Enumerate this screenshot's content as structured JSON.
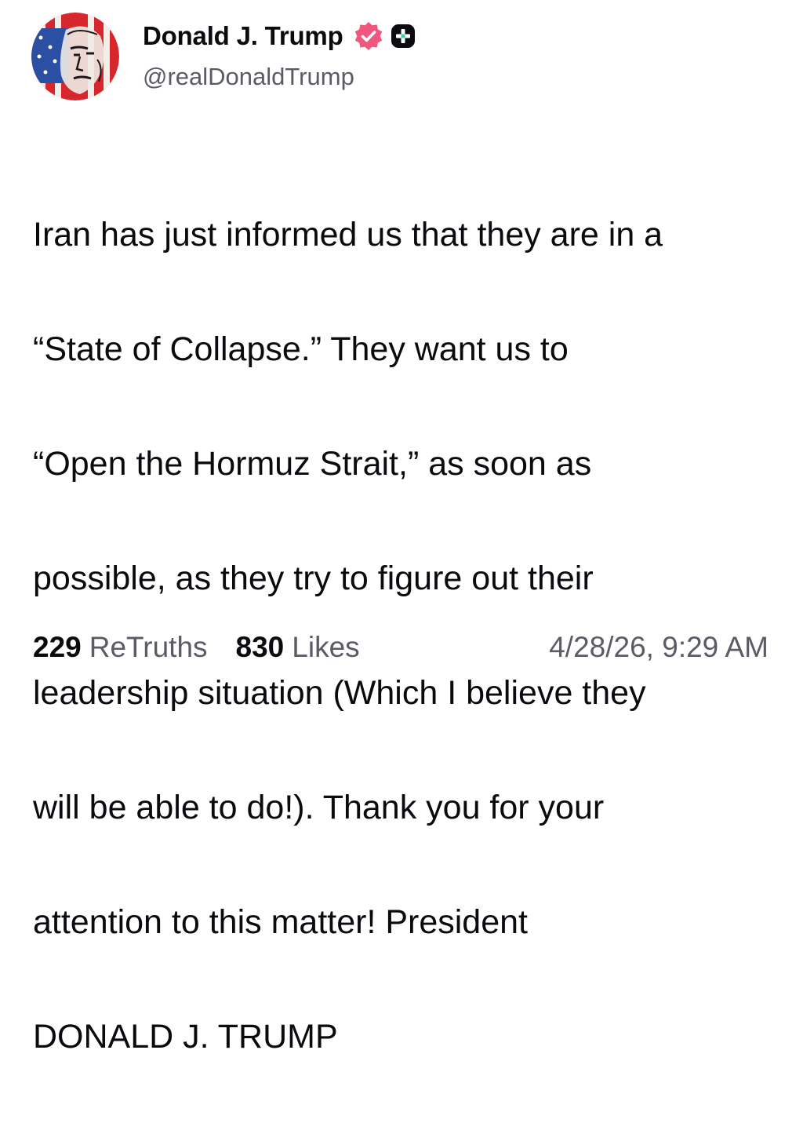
{
  "post": {
    "author": {
      "display_name": "Donald J. Trump",
      "handle": "@realDonaldTrump",
      "verified_icon": "verified-badge-icon",
      "badge_icon": "plus-badge-icon",
      "verified_color": "#f1577e"
    },
    "lines": [
      "Iran has just informed us that they are in a",
      "“State of Collapse.” They want us to",
      "“Open the Hormuz Strait,” as soon as",
      "possible, as they try to figure out their",
      "leadership situation (Which I believe they",
      "will be able to do!). Thank you for your",
      "attention to this matter! President",
      "DONALD J. TRUMP"
    ],
    "stats": {
      "retruths_count": "229",
      "retruths_label": "ReTruths",
      "likes_count": "830",
      "likes_label": "Likes"
    },
    "timestamp": "4/28/26, 9:29 AM"
  }
}
